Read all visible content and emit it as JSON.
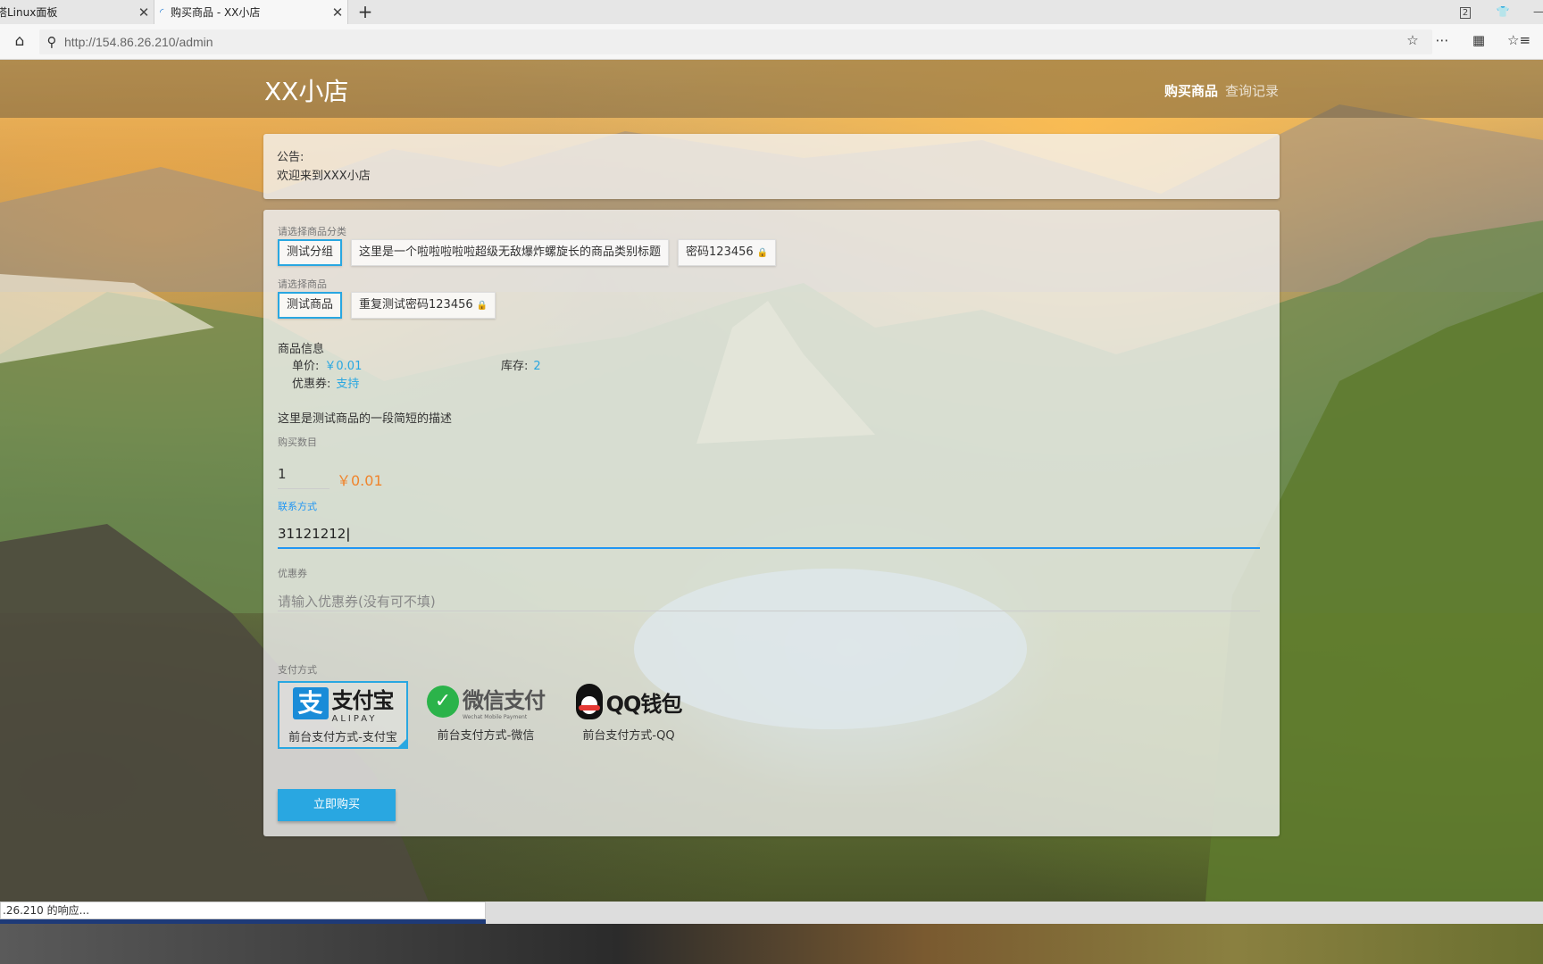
{
  "browser": {
    "tabs": [
      {
        "title": "塔Linux面板"
      },
      {
        "title": "购买商品 - XX小店"
      }
    ],
    "address": "http://154.86.26.210/admin",
    "window_counter": "2",
    "status": ".26.210 的响应..."
  },
  "navbar": {
    "brand": "XX小店",
    "links": [
      "购买商品",
      "查询记录"
    ]
  },
  "notice": {
    "label": "公告:",
    "text": "欢迎来到XXX小店"
  },
  "form": {
    "category_label": "请选择商品分类",
    "categories": [
      {
        "label": "测试分组",
        "active": true,
        "locked": false
      },
      {
        "label": "这里是一个啦啦啦啦啦超级无敌爆炸螺旋长的商品类别标题",
        "active": false,
        "locked": false
      },
      {
        "label": "密码123456",
        "active": false,
        "locked": true
      }
    ],
    "product_label": "请选择商品",
    "products": [
      {
        "label": "测试商品",
        "active": true,
        "locked": false
      },
      {
        "label": "重复测试密码123456",
        "active": false,
        "locked": true
      }
    ],
    "info": {
      "title": "商品信息",
      "price_key": "单价:",
      "price_val": "￥0.01",
      "stock_key": "库存:",
      "stock_val": "2",
      "coupon_key": "优惠券:",
      "coupon_val": "支持"
    },
    "description": "这里是测试商品的一段简短的描述",
    "quantity_label": "购买数目",
    "quantity": "1",
    "total": "￥0.01",
    "contact_label": "联系方式",
    "contact_value": "31121212",
    "coupon_label": "优惠券",
    "coupon_placeholder": "请输入优惠券(没有可不填)",
    "payment_label": "支付方式",
    "payments": [
      {
        "logo_text": "支付宝",
        "logo_sub": "ALIPAY",
        "name": "前台支付方式-支付宝",
        "active": true
      },
      {
        "logo_text": "微信支付",
        "logo_sub": "Wechat Mobile Payment",
        "name": "前台支付方式-微信",
        "active": false
      },
      {
        "logo_text": "QQ钱包",
        "logo_sub": "",
        "name": "前台支付方式-QQ",
        "active": false
      }
    ],
    "submit": "立即购买"
  },
  "colors": {
    "accent": "#29a7e1",
    "focus": "#2196f3",
    "price": "#f0842c"
  }
}
